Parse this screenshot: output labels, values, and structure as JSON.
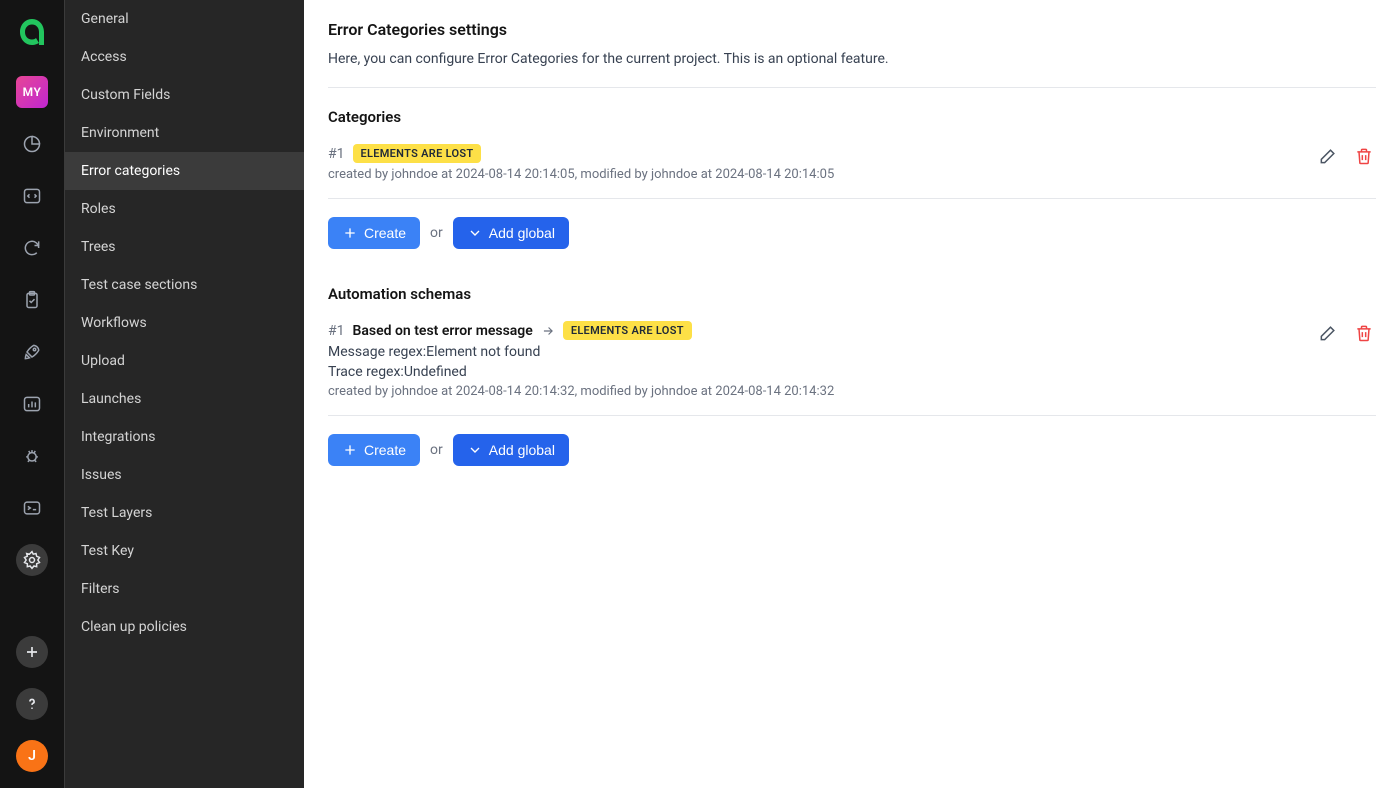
{
  "rail": {
    "project_badge": "MY",
    "user_initial": "J"
  },
  "submenu": {
    "items": [
      "General",
      "Access",
      "Custom Fields",
      "Environment",
      "Error categories",
      "Roles",
      "Trees",
      "Test case sections",
      "Workflows",
      "Upload",
      "Launches",
      "Integrations",
      "Issues",
      "Test Layers",
      "Test Key",
      "Filters",
      "Clean up policies"
    ],
    "active_index": 4
  },
  "page": {
    "title": "Error Categories settings",
    "description": "Here, you can configure Error Categories for the current project. This is an optional feature."
  },
  "categories": {
    "title": "Categories",
    "items": [
      {
        "id": "#1",
        "tag": "ELEMENTS ARE LOST",
        "meta": "created by johndoe at 2024-08-14 20:14:05, modified by johndoe at 2024-08-14 20:14:05"
      }
    ],
    "create_label": "Create",
    "or_label": "or",
    "add_global_label": "Add global"
  },
  "schemas": {
    "title": "Automation schemas",
    "items": [
      {
        "id": "#1",
        "name": "Based on test error message",
        "tag": "ELEMENTS ARE LOST",
        "message_regex_label": "Message regex:",
        "message_regex_value": "Element not found",
        "trace_regex_label": "Trace regex:",
        "trace_regex_value": "Undefined",
        "meta": "created by johndoe at 2024-08-14 20:14:32, modified by johndoe at 2024-08-14 20:14:32"
      }
    ],
    "create_label": "Create",
    "or_label": "or",
    "add_global_label": "Add global"
  }
}
